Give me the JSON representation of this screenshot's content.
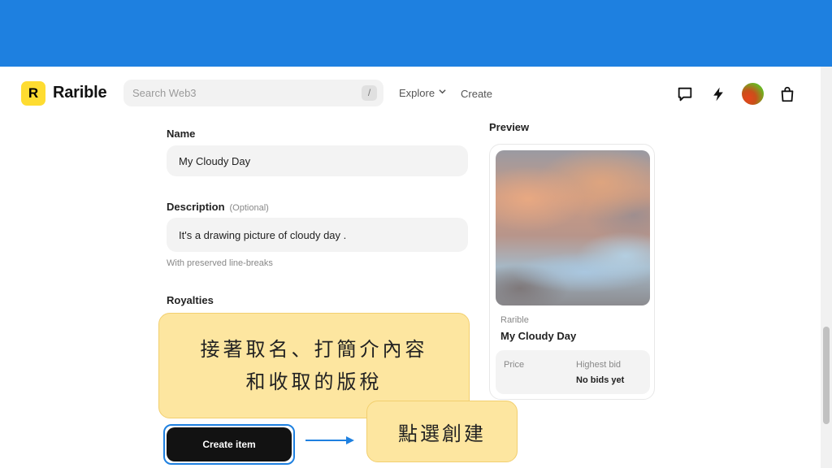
{
  "header": {
    "logo_letter": "R",
    "brand": "Rarible",
    "search_placeholder": "Search Web3",
    "search_shortcut": "/",
    "nav": {
      "explore": "Explore",
      "create": "Create"
    },
    "icons": [
      "chat-icon",
      "lightning-icon",
      "avatar",
      "bag-icon"
    ]
  },
  "form": {
    "name_label": "Name",
    "name_value": "My Cloudy Day",
    "description_label": "Description",
    "description_optional": "(Optional)",
    "description_value": "It's a drawing picture of cloudy day .",
    "description_hint": "With preserved line-breaks",
    "royalties_label": "Royalties",
    "create_button": "Create item"
  },
  "preview": {
    "label": "Preview",
    "owner": "Rarible",
    "title": "My Cloudy Day",
    "price_label": "Price",
    "bid_label": "Highest bid",
    "bid_value": "No bids yet"
  },
  "annotations": {
    "callout_main_line1": "接著取名、打簡介內容",
    "callout_main_line2": "和收取的版稅",
    "callout_click": "點選創建"
  },
  "colors": {
    "top_band": "#1e80e0",
    "logo_yellow": "#fedc31",
    "callout_fill": "#fde6a0",
    "button_dark": "#121212",
    "highlight_blue": "#1e80e0"
  }
}
